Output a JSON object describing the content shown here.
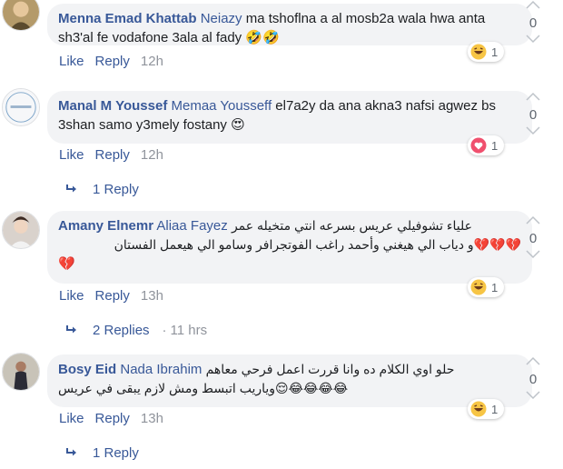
{
  "comments": [
    {
      "author": "Menna Emad Khattab",
      "mention": "Neiazy",
      "text": "ma tshoflna a al mosb2a wala hwa anta sh3'al fe vodafone 3ala al fady",
      "emojis": "🤣🤣",
      "like": "Like",
      "reply": "Reply",
      "time": "12h",
      "reaction_icon": "laugh-icon",
      "reaction_count": "1",
      "votes": "0"
    },
    {
      "author": "Manal M Youssef",
      "mention": "Memaa Yousseff",
      "text": "el7a2y da ana akna3 nafsi agwez bs 3shan samo y3mely fostany",
      "emojis": "😍",
      "like": "Like",
      "reply": "Reply",
      "time": "12h",
      "reaction_icon": "love-icon",
      "reaction_count": "1",
      "votes": "0",
      "replies_label": "1 Reply"
    },
    {
      "author": "Amany Elnemr",
      "mention": "Aliaa Fayez",
      "text_line1": "علياء تشوفيلي عريس بسرعه انتي متخيله عمر",
      "text_line2": "💔💔💔و دياب الي هيغني وأحمد راغب الفوتجرافر وسامو الي هيعمل الفستان",
      "text_line3": "💔",
      "like": "Like",
      "reply": "Reply",
      "time": "13h",
      "reaction_icon": "laugh-icon",
      "reaction_count": "1",
      "votes": "0",
      "replies_label": "2 Replies",
      "replies_time": "11 hrs"
    },
    {
      "author": "Bosy Eid",
      "mention": "Nada Ibrahim",
      "text_line1": "حلو اوي الكلام ده وانا قررت اعمل فرحي معاهم",
      "text_line2": "😂😂😂😂😌وياريب اتبسط ومش لازم يبقى في عريس",
      "like": "Like",
      "reply": "Reply",
      "time": "13h",
      "reaction_icon": "laugh-icon",
      "reaction_count": "1",
      "votes": "0",
      "replies_label": "1 Reply"
    }
  ],
  "colors": {
    "link": "#385898",
    "bubble": "#f2f3f5",
    "muted": "#90949c"
  }
}
